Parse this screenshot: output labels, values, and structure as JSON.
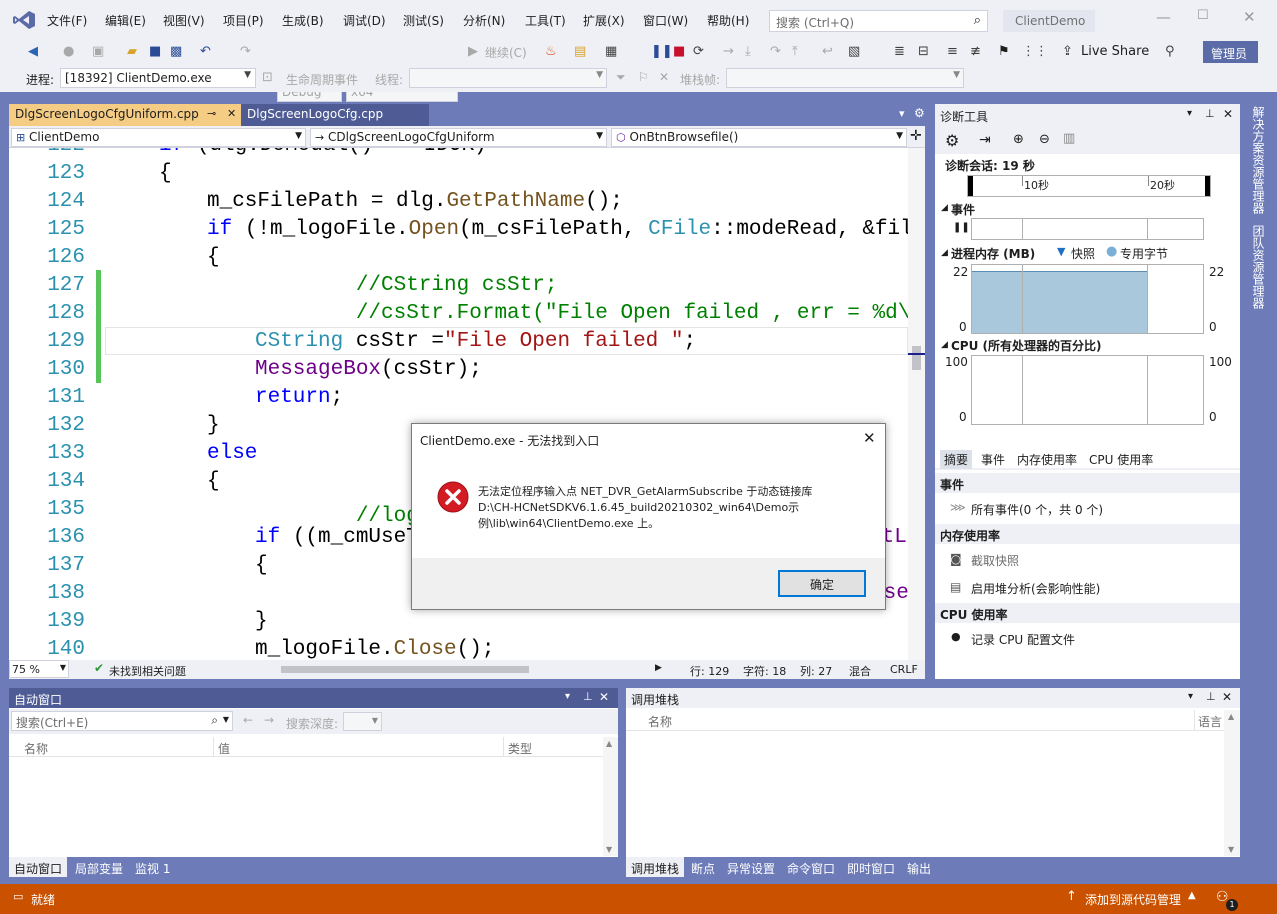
{
  "menubar": {
    "items": [
      "文件(F)",
      "编辑(E)",
      "视图(V)",
      "项目(P)",
      "生成(B)",
      "调试(D)",
      "测试(S)",
      "分析(N)",
      "工具(T)",
      "扩展(X)",
      "窗口(W)",
      "帮助(H)"
    ],
    "search_placeholder": "搜索 (Ctrl+Q)",
    "app_name": "ClientDemo"
  },
  "toolbar": {
    "config": "Debug",
    "platform": "x64",
    "continue_label": "继续(C)",
    "live_share": "Live Share",
    "admin": "管理员"
  },
  "toolbar2": {
    "process_label": "进程:",
    "process_value": "[18392] ClientDemo.exe",
    "lifecycle_label": "生命周期事件",
    "thread_label": "线程:",
    "stackframe_label": "堆栈帧:"
  },
  "editor": {
    "tabs": [
      "DlgScreenLogoCfgUniform.cpp",
      "DlgScreenLogoCfg.cpp"
    ],
    "nav": {
      "project": "ClientDemo",
      "class": "CDlgScreenLogoCfgUniform",
      "method": "OnBtnBrowsefile()"
    },
    "lines": [
      {
        "num": "122",
        "code": "if (dlg.DoModal() == IDOK)"
      },
      {
        "num": "123",
        "code": "{"
      },
      {
        "num": "124",
        "code": "    m_csFilePath = dlg.GetPathName();"
      },
      {
        "num": "125",
        "code": "    if (!m_logoFile.Open(m_csFilePath, CFile::modeRead, &fileEx"
      },
      {
        "num": "126",
        "code": "    {"
      },
      {
        "num": "127",
        "code": "        //CString csStr;"
      },
      {
        "num": "128",
        "code": "        //csStr.Format(\"File Open failed , err = %d\\n\", fileExc"
      },
      {
        "num": "129",
        "code": "        CString csStr =\"File Open failed \";"
      },
      {
        "num": "130",
        "code": "        MessageBox(csStr);"
      },
      {
        "num": "131",
        "code": "        return;"
      },
      {
        "num": "132",
        "code": "    }"
      },
      {
        "num": "133",
        "code": "    else"
      },
      {
        "num": "134",
        "code": "    {"
      },
      {
        "num": "135",
        "code": "        //logo大小小于"
      },
      {
        "num": "136",
        "code": "        if ((m_cmUseT"
      },
      {
        "num": "137",
        "code": "        {"
      },
      {
        "num": "138",
        "code": "            MessageBo"
      },
      {
        "num": "139",
        "code": "        }"
      },
      {
        "num": "140",
        "code": "        m_logoFile.Close();"
      }
    ],
    "line136_tail": "ctLe",
    "line138_tail": "ase",
    "status": {
      "zoom": "75 %",
      "issues": "未找到相关问题",
      "line": "行: 129",
      "char": "字符: 18",
      "col": "列: 27",
      "mixed": "混合",
      "eol": "CRLF"
    }
  },
  "diagnostics": {
    "title": "诊断工具",
    "session": "诊断会话: 19 秒",
    "tick1": "10秒",
    "tick2": "20秒",
    "events_label": "事件",
    "memory_label": "进程内存 (MB)",
    "snapshot_legend": "快照",
    "private_bytes_legend": "专用字节",
    "mem_max": "22",
    "mem_min": "0",
    "cpu_label": "CPU (所有处理器的百分比)",
    "cpu_max": "100",
    "cpu_min": "0",
    "tabs": [
      "摘要",
      "事件",
      "内存使用率",
      "CPU 使用率"
    ],
    "events_section": "事件",
    "all_events": "所有事件(0 个，共 0 个)",
    "memory_section": "内存使用率",
    "take_snapshot": "截取快照",
    "enable_heap": "启用堆分析(会影响性能)",
    "cpu_section": "CPU 使用率",
    "record_cpu": "记录 CPU 配置文件"
  },
  "sidebar": {
    "items": [
      "解决方案资源管理器",
      "团队资源管理器"
    ]
  },
  "autos": {
    "title": "自动窗口",
    "search_placeholder": "搜索(Ctrl+E)",
    "search_depth": "搜索深度:",
    "columns": [
      "名称",
      "值",
      "类型"
    ],
    "tabs": [
      "自动窗口",
      "局部变量",
      "监视 1"
    ]
  },
  "callstack": {
    "title": "调用堆栈",
    "columns": [
      "名称",
      "语言"
    ],
    "tabs": [
      "调用堆栈",
      "断点",
      "异常设置",
      "命令窗口",
      "即时窗口",
      "输出"
    ]
  },
  "dialog": {
    "title": "ClientDemo.exe - 无法找到入口",
    "message_line1": "无法定位程序输入点 NET_DVR_GetAlarmSubscribe 于动态链接库",
    "message_line2": "D:\\CH-HCNetSDKV6.1.6.45_build20210302_win64\\Demo示",
    "message_line3": "例\\lib\\win64\\ClientDemo.exe 上。",
    "ok_label": "确定"
  },
  "statusbar": {
    "ready": "就绪",
    "source_control": "添加到源代码管理",
    "notifications": "1"
  },
  "colors": {
    "statusbar": "#ca5100",
    "accent": "#6d7cb8",
    "tab_active": "#f5cc84"
  }
}
